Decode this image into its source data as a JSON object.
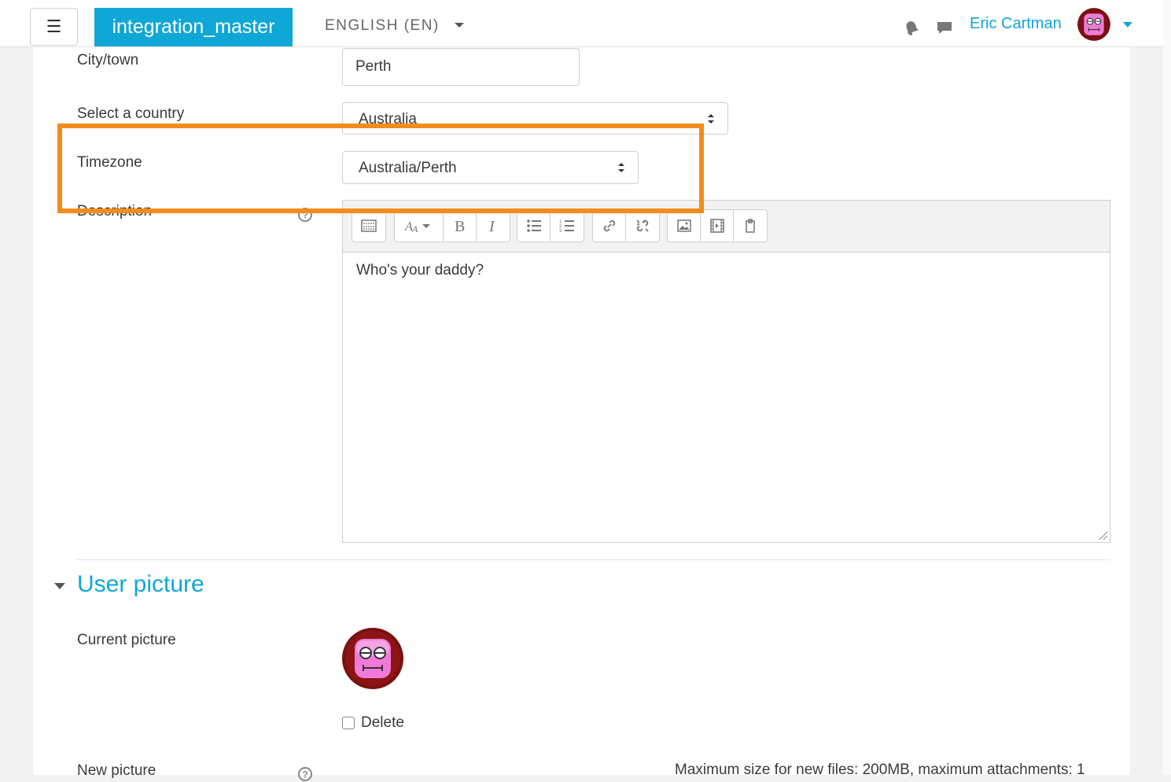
{
  "navbar": {
    "menu_icon": "☰",
    "site_name": "integration_master",
    "language": "ENGLISH (EN)",
    "user_name": "Eric Cartman",
    "icons": [
      "hamburger-icon",
      "bell-icon",
      "chat-icon",
      "avatar",
      "chevron-down-icon"
    ]
  },
  "form": {
    "city": {
      "label": "City/town",
      "value": "Perth"
    },
    "country": {
      "label": "Select a country",
      "value": "Australia"
    },
    "timezone": {
      "label": "Timezone",
      "value": "Australia/Perth"
    },
    "description": {
      "label": "Description",
      "content": "Who's your daddy?",
      "toolbar_icons": [
        "toolbar-toggle-icon",
        "font-style-icon",
        "bold-icon",
        "italic-icon",
        "unordered-list-icon",
        "ordered-list-icon",
        "link-icon",
        "unlink-icon",
        "image-icon",
        "media-icon",
        "paste-icon"
      ]
    }
  },
  "user_picture": {
    "section_title": "User picture",
    "current_label": "Current picture",
    "delete_label": "Delete",
    "new_picture_label": "New picture",
    "max_size_text": "Maximum size for new files: 200MB, maximum attachments: 1"
  },
  "colors": {
    "accent": "#0fa7d6",
    "highlight": "#f28c1c",
    "avatar_pink": "#f07ad8",
    "avatar_ring": "#7a1010"
  }
}
